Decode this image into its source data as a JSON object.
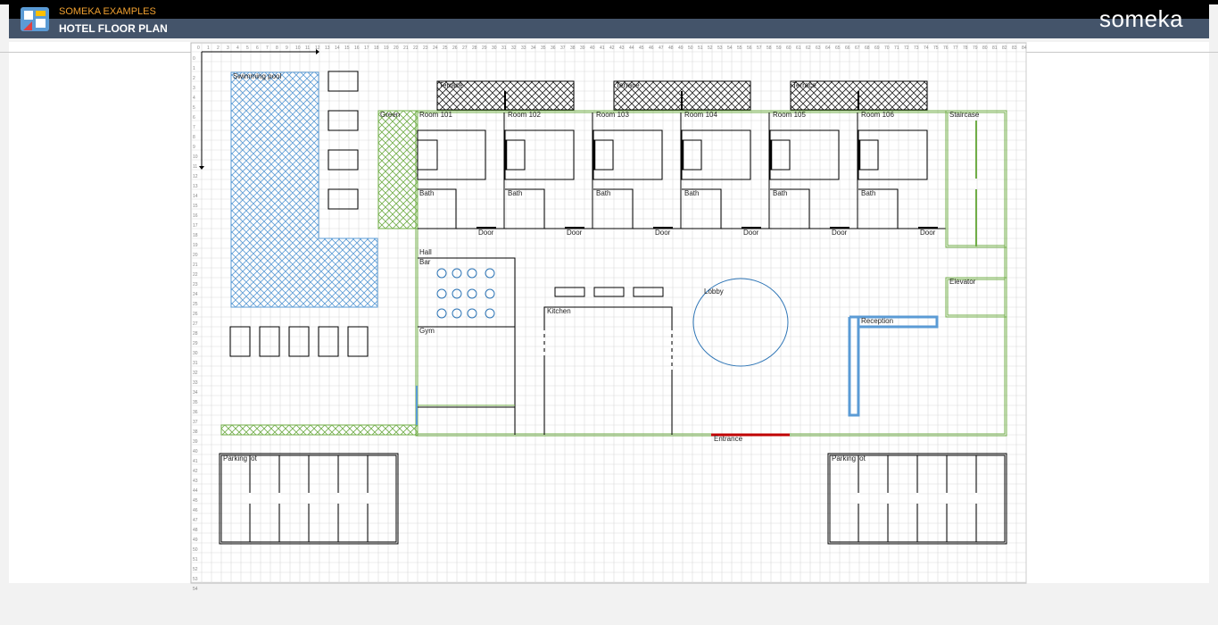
{
  "header": {
    "examples_label": "SOMEKA EXAMPLES",
    "title": "HOTEL FLOOR PLAN",
    "brand": "someka",
    "brand_icon": "someka-logo-icon",
    "logo_icon": "floor-plan-tile-icon"
  },
  "colors": {
    "outline_green": "#70ad47",
    "pool_blue": "#5b9bd5",
    "lobby_blue": "#2e75b6",
    "entrance_red": "#c00000",
    "header_black": "#000000",
    "header_slate": "#44546a",
    "accent_orange": "#f0a030"
  },
  "floor": {
    "labels": {
      "swimming_pool": "Swimming pool",
      "green_area": "Green",
      "hall": "Hall",
      "bar": "Bar",
      "gym": "Gym",
      "kitchen": "Kitchen",
      "lobby": "Lobby",
      "staircase": "Staircase",
      "elevator": "Elevator",
      "reception": "Reception",
      "entrance": "Entrance"
    },
    "terraces": [
      "Terrace",
      "Terrace",
      "Terrace"
    ],
    "rooms": [
      {
        "name": "Room 101",
        "bath": "Bath",
        "door": "Door"
      },
      {
        "name": "Room 102",
        "bath": "Bath",
        "door": "Door"
      },
      {
        "name": "Room 103",
        "bath": "Bath",
        "door": "Door"
      },
      {
        "name": "Room 104",
        "bath": "Bath",
        "door": "Door"
      },
      {
        "name": "Room 105",
        "bath": "Bath",
        "door": "Door"
      },
      {
        "name": "Room 106",
        "bath": "Bath",
        "door": "Door"
      }
    ],
    "parking_lots": [
      "Parking lot",
      "Parking lot"
    ]
  },
  "ruler": {
    "columns": [
      "0",
      "1",
      "2",
      "3",
      "4",
      "5",
      "6",
      "7",
      "8",
      "9",
      "10",
      "11",
      "12",
      "13",
      "14",
      "15",
      "16",
      "17",
      "18",
      "19",
      "20",
      "21",
      "22",
      "23",
      "24",
      "25",
      "26",
      "27",
      "28",
      "29",
      "30",
      "31",
      "32",
      "33",
      "34",
      "35",
      "36",
      "37",
      "38",
      "39",
      "40",
      "41",
      "42",
      "43",
      "44",
      "45",
      "46",
      "47",
      "48",
      "49",
      "50",
      "51",
      "52",
      "53",
      "54",
      "55",
      "56",
      "57",
      "58",
      "59",
      "60",
      "61",
      "62",
      "63",
      "64",
      "65",
      "66",
      "67",
      "68",
      "69",
      "70",
      "71",
      "72",
      "73",
      "74",
      "75",
      "76",
      "77",
      "78",
      "79",
      "80",
      "81",
      "82",
      "83",
      "84"
    ],
    "rows": [
      "0",
      "1",
      "2",
      "3",
      "4",
      "5",
      "6",
      "7",
      "8",
      "9",
      "10",
      "11",
      "12",
      "13",
      "14",
      "15",
      "16",
      "17",
      "18",
      "19",
      "20",
      "21",
      "22",
      "23",
      "24",
      "25",
      "26",
      "27",
      "28",
      "29",
      "30",
      "31",
      "32",
      "33",
      "34",
      "35",
      "36",
      "37",
      "38",
      "39",
      "40",
      "41",
      "42",
      "43",
      "44",
      "45",
      "46",
      "47",
      "48",
      "49",
      "50",
      "51",
      "52",
      "53",
      "54"
    ]
  }
}
